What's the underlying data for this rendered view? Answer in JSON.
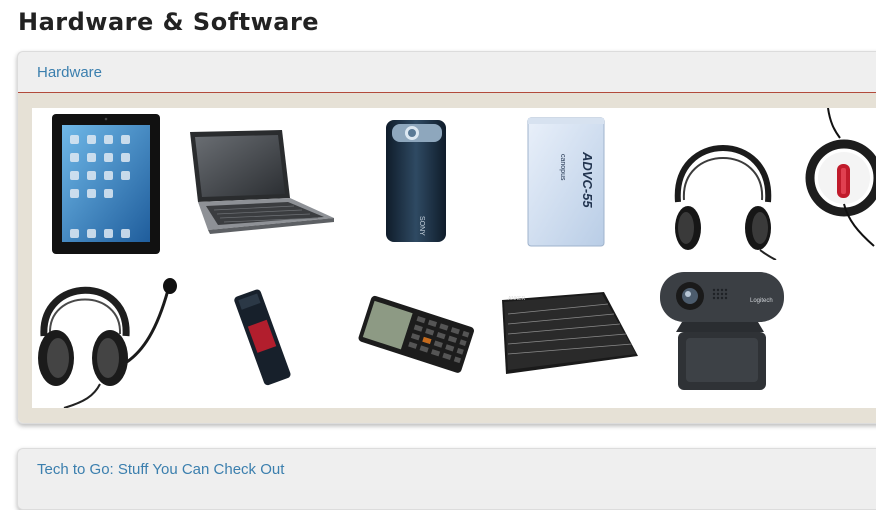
{
  "page": {
    "title": "Hardware & Software"
  },
  "panels": [
    {
      "title": "Hardware"
    },
    {
      "title": "Tech to Go: Stuff You Can Check Out"
    }
  ],
  "gallery": {
    "items": [
      {
        "icon": "ipad-tablet-icon"
      },
      {
        "icon": "laptop-icon"
      },
      {
        "icon": "pocket-camcorder-icon"
      },
      {
        "icon": "video-converter-box-icon",
        "label": "ADVC-55",
        "brand": "canopus"
      },
      {
        "icon": "headphones-icon"
      },
      {
        "icon": "usb-microphone-icon"
      },
      {
        "icon": "headset-with-mic-icon"
      },
      {
        "icon": "usb-flash-drive-icon"
      },
      {
        "icon": "graphing-calculator-icon"
      },
      {
        "icon": "wireless-keyboard-icon",
        "brand": "ANKER"
      },
      {
        "icon": "webcam-icon",
        "brand": "Logitech"
      }
    ]
  },
  "colors": {
    "title": "#222222",
    "link": "#3b7fae",
    "header_rule": "#b24a3b",
    "panel_body": "#e6e1d6"
  }
}
